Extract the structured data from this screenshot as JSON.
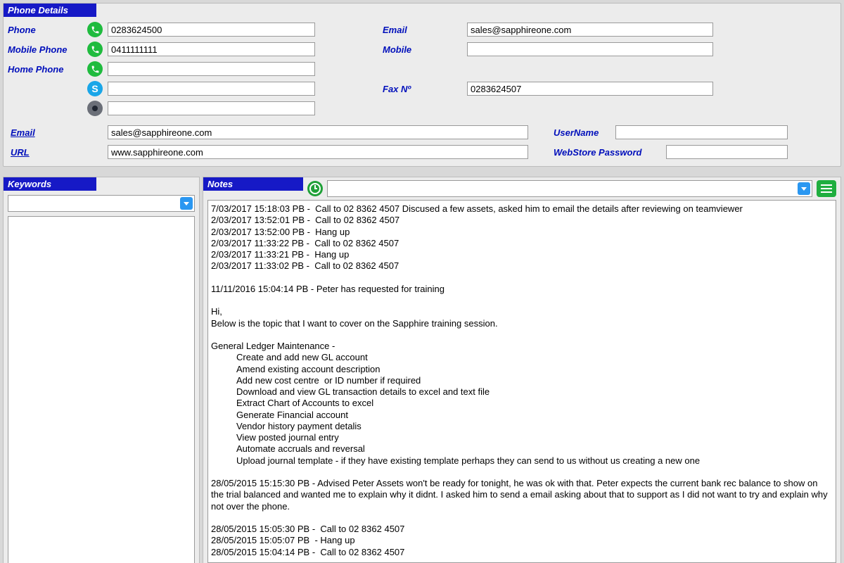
{
  "phone_section_title": "Phone Details",
  "labels": {
    "phone": "Phone",
    "mobile_phone": "Mobile Phone",
    "home_phone": "Home Phone",
    "email_right": "Email",
    "mobile_right": "Mobile",
    "fax": "Fax Nº",
    "email_link": "Email",
    "url_link": "URL",
    "username": "UserName",
    "webstore_pw": "WebStore Password"
  },
  "fields": {
    "phone": "0283624500",
    "mobile_phone": "0411111111",
    "home_phone": "",
    "skype": "",
    "facetime": "",
    "email_right": "sales@sapphireone.com",
    "mobile_right": "",
    "fax": "0283624507",
    "email_long": "sales@sapphireone.com",
    "url_long": "www.sapphireone.com",
    "username": "",
    "webstore_pw": ""
  },
  "keywords_title": "Keywords",
  "notes_title": "Notes",
  "notes": {
    "entries_top": [
      "7/03/2017 15:18:03 PB -  Call to 02 8362 4507 Discused a few assets, asked him to email the details after reviewing on teamviewer",
      "2/03/2017 13:52:01 PB -  Call to 02 8362 4507",
      "2/03/2017 13:52:00 PB -  Hang up",
      "2/03/2017 11:33:22 PB -  Call to 02 8362 4507",
      "2/03/2017 11:33:21 PB -  Hang up",
      "2/03/2017 11:33:02 PB -  Call to 02 8362 4507"
    ],
    "training_header": "11/11/2016 15:04:14 PB - Peter has requested for training",
    "hi": "Hi,",
    "below": "Below is the topic that I want to cover on the Sapphire training session.",
    "gl_header": "General Ledger Maintenance -",
    "gl_items": [
      "Create and add new GL account",
      "Amend existing account description",
      "Add new cost centre  or ID number if required",
      "Download and view GL transaction details to excel and text file",
      "Extract Chart of Accounts to excel",
      "Generate Financial account",
      "Vendor history payment detalis",
      "View posted journal entry",
      "Automate accruals and reversal",
      "Upload journal template - if they have existing template perhaps they can send to us without us creating a new one"
    ],
    "entry_2015_a": "28/05/2015 15:15:30 PB - Advised Peter Assets won't be ready for tonight, he was ok with that. Peter expects the current bank rec balance to show on the trial balanced and wanted me to explain why it didnt. I asked him to send a email asking about that to support as I did not want to try and explain why not over the phone.",
    "entries_2015_calls": [
      "28/05/2015 15:05:30 PB -  Call to 02 8362 4507",
      "28/05/2015 15:05:07 PB  - Hang up",
      "28/05/2015 15:04:14 PB -  Call to 02 8362 4507"
    ]
  }
}
